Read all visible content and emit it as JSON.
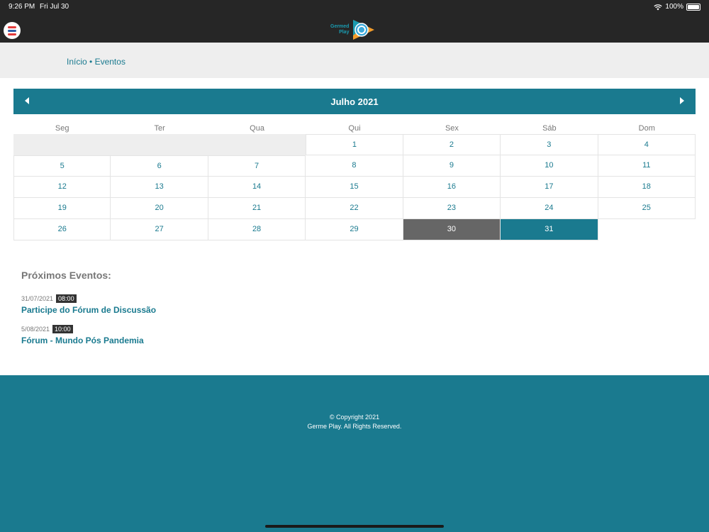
{
  "status_bar": {
    "time": "9:26 PM",
    "date": "Fri Jul 30",
    "battery": "100%",
    "icons": [
      "wifi-icon",
      "battery-icon"
    ]
  },
  "header": {
    "menu_icon": "menu-icon",
    "logo_line1": "Germed",
    "logo_line2": "Play"
  },
  "breadcrumb": {
    "home": "Início",
    "separator": "•",
    "current": "Eventos"
  },
  "calendar": {
    "title": "Julho 2021",
    "prev_icon": "caret-left-icon",
    "next_icon": "caret-right-icon",
    "weekdays": [
      "Seg",
      "Ter",
      "Qua",
      "Qui",
      "Sex",
      "Sáb",
      "Dom"
    ],
    "days": [
      "1",
      "2",
      "3",
      "4",
      "5",
      "6",
      "7",
      "8",
      "9",
      "10",
      "11",
      "12",
      "13",
      "14",
      "15",
      "16",
      "17",
      "18",
      "19",
      "20",
      "21",
      "22",
      "23",
      "24",
      "25",
      "26",
      "27",
      "28",
      "29",
      "30",
      "31"
    ],
    "leading_blank_days": 3,
    "today": "30",
    "selected": "31"
  },
  "events": {
    "heading": "Próximos Eventos:",
    "items": [
      {
        "date": "31/07/2021",
        "time": "08:00",
        "title": "Participe do Fórum de Discussão"
      },
      {
        "date": "5/08/2021",
        "time": "10:00",
        "title": "Fórum - Mundo Pós Pandemia"
      }
    ]
  },
  "footer": {
    "line1": "© Copyright 2021",
    "line2": "Germe Play. All Rights Reserved."
  },
  "colors": {
    "primary": "#1a7a8f",
    "dark_bar": "#262626",
    "today_bg": "#666666",
    "light_bg": "#eeeeee"
  }
}
